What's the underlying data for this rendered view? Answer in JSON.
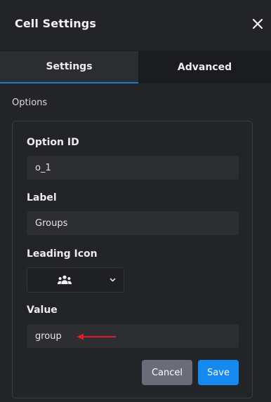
{
  "header": {
    "title": "Cell Settings",
    "close_icon": "close-icon"
  },
  "tabs": [
    {
      "label": "Settings",
      "active": true
    },
    {
      "label": "Advanced",
      "active": false
    }
  ],
  "options": {
    "section_label": "Options",
    "option_id": {
      "label": "Option ID",
      "value": "o_1"
    },
    "label_field": {
      "label": "Label",
      "value": "Groups"
    },
    "leading_icon": {
      "label": "Leading Icon",
      "selected_icon": "group-icon"
    },
    "value_field": {
      "label": "Value",
      "value": "group"
    }
  },
  "actions": {
    "cancel_label": "Cancel",
    "save_label": "Save"
  },
  "colors": {
    "accent": "#1589f0",
    "annotation_arrow": "#e01b24",
    "cancel_bg": "#6a6d78"
  }
}
